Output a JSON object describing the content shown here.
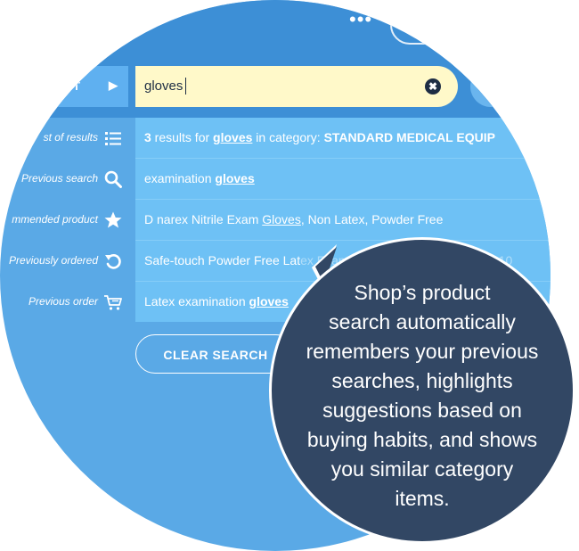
{
  "header": {
    "menu_label": "•••"
  },
  "search": {
    "category_label": "ENT",
    "arrow": "▶",
    "value": "gloves",
    "clear_symbol": "✖"
  },
  "results": [
    {
      "label": "st of results",
      "icon": "list-icon",
      "text_parts": [
        {
          "t": "3",
          "bold": true
        },
        {
          "t": " results for "
        },
        {
          "t": "gloves",
          "bold": true,
          "underline": true
        },
        {
          "t": " in category: "
        },
        {
          "t": "STANDARD MEDICAL EQUIP",
          "bold": true
        }
      ]
    },
    {
      "label": "Previous search",
      "icon": "search-icon",
      "text_parts": [
        {
          "t": "examination "
        },
        {
          "t": "gloves",
          "bold": true,
          "underline": true
        }
      ]
    },
    {
      "label": "mmended product",
      "icon": "star-icon",
      "text_parts": [
        {
          "t": "D  narex Nitrile Exam "
        },
        {
          "t": "Gloves",
          "underline": true
        },
        {
          "t": ", Non Latex, Powder Free"
        }
      ]
    },
    {
      "label": "Previously ordered",
      "icon": "reorder-icon",
      "text_parts": [
        {
          "t": "Safe-touch Powder Free Lat"
        },
        {
          "t": "ex Examination ",
          "faint": true
        },
        {
          "t": "Gloves",
          "faint": true,
          "underline": true
        },
        {
          "t": ", Non-nitrile, 10",
          "faint": true
        }
      ]
    },
    {
      "label": "Previous order",
      "icon": "cart-icon",
      "text_parts": [
        {
          "t": "Latex examination "
        },
        {
          "t": "gloves",
          "bold": true,
          "underline": true
        }
      ]
    }
  ],
  "clear_button": "CLEAR SEARCH",
  "callout": {
    "lines": [
      "Shop’s product",
      "search automatically",
      "remembers your previous",
      "searches, highlights",
      "suggestions based on",
      "buying habits, and shows",
      "you similar category",
      "items."
    ]
  },
  "colors": {
    "background": "#5aa9e6",
    "header_band": "#3d8fd6",
    "row": "#6ec1f5",
    "search_field": "#fff9c9",
    "callout": "#324764"
  }
}
